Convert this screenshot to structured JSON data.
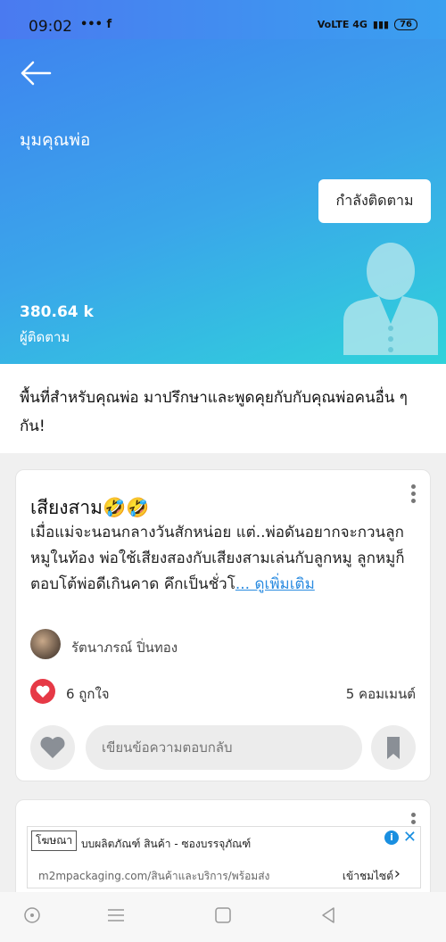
{
  "status_bar": {
    "time": "09:02",
    "left_icons": "••• f",
    "network": "VoLTE 4G",
    "battery": "76"
  },
  "header": {
    "title": "มุมคุณพ่อ",
    "follow_button": "กำลังติดตาม",
    "followers_count": "380.64 k",
    "followers_label": "ผู้ติดตาม"
  },
  "intro": {
    "text": "พื้นที่สำหรับคุณพ่อ มาปรึกษาและพูดคุยกับกับคุณพ่อคนอื่น ๆ กัน!"
  },
  "post": {
    "title": "เสียงสาม🤣🤣",
    "body": "เมื่อแม่จะนอนกลางวันสักหน่อย แต่..พ่อดันอยากจะกวนลูกหมูในท้อง พ่อใช้เสียงสองกับเสียงสามเล่นกับลูกหมู ลูกหมูก็ตอบโต้พ่อดีเกินคาด คึกเป็นชั่วโ",
    "more_link": "... ดูเพิ่มเติม",
    "author": "รัตนาภรณ์ ปิ่นทอง",
    "likes": "6 ถูกใจ",
    "comments": "5 คอมเมนต์",
    "reply_placeholder": "เขียนข้อความตอบกลับ"
  },
  "ad": {
    "badge": "โฆษณา",
    "title": "บบผลิตภัณฑ์ สินค้า - ซองบรรจุภัณฑ์",
    "url": "m2mpackaging.com/สินค้าและบริการ/พร้อมส่ง",
    "visit_label": "เข้าชมไซต์"
  },
  "icons": {
    "back": "arrow-left-icon",
    "menu": "more-vertical-icon",
    "heart": "heart-icon",
    "bookmark": "bookmark-icon"
  },
  "colors": {
    "hero_start": "#3f7ff0",
    "hero_end": "#2fd3da",
    "like_red": "#e63946",
    "link_blue": "#2a8be0"
  }
}
